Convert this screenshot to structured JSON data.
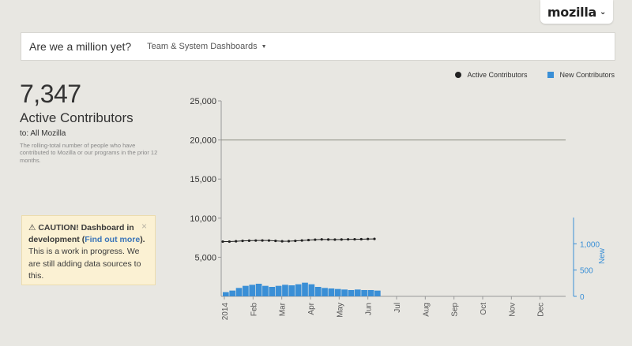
{
  "brand": {
    "name": "mozilla",
    "chevron": "chevron-down-icon"
  },
  "topbar": {
    "title": "Are we a million yet?",
    "dropdown_label": "Team & System Dashboards"
  },
  "stat": {
    "value": "7,347",
    "label": "Active Contributors",
    "to": "to: All Mozilla",
    "description": "The rolling-total number of people who have contributed to Mozilla or our programs in the prior 12 months."
  },
  "caution": {
    "icon": "warning-icon",
    "heading": "CAUTION! Dashboard in development",
    "paren_open": "(",
    "link": "Find out more",
    "paren_close": ").",
    "body": "This is a work in progress. We are still adding data sources to this.",
    "close": "×"
  },
  "legend": {
    "active": "Active Contributors",
    "new": "New Contributors"
  },
  "colors": {
    "active": "#222222",
    "new": "#3a8fd6",
    "axis_right": "#3a8fd6"
  },
  "chart_data": {
    "type": "line",
    "x_ticks": [
      "2014",
      "Feb",
      "Mar",
      "Apr",
      "May",
      "Jun",
      "Jul",
      "Aug",
      "Sep",
      "Oct",
      "Nov",
      "Dec"
    ],
    "ylim": [
      0,
      25000
    ],
    "y_ticks": [
      "25,000",
      "20,000",
      "15,000",
      "10,000",
      "5,000"
    ],
    "y2label": "New",
    "y2lim": [
      0,
      1500
    ],
    "y2_ticks": [
      "1,000",
      "500",
      "0"
    ],
    "series": [
      {
        "name": "Active Contributors",
        "values": [
          7000,
          7000,
          7050,
          7100,
          7120,
          7140,
          7150,
          7140,
          7100,
          7050,
          7060,
          7100,
          7150,
          7200,
          7250,
          7280,
          7270,
          7260,
          7270,
          7290,
          7300,
          7310,
          7330,
          7347
        ]
      },
      {
        "name": "New Contributors",
        "values": [
          80,
          110,
          160,
          200,
          220,
          240,
          200,
          180,
          200,
          220,
          210,
          230,
          260,
          230,
          180,
          160,
          150,
          140,
          130,
          120,
          130,
          120,
          120,
          110
        ]
      }
    ],
    "reference_line": 20000
  }
}
